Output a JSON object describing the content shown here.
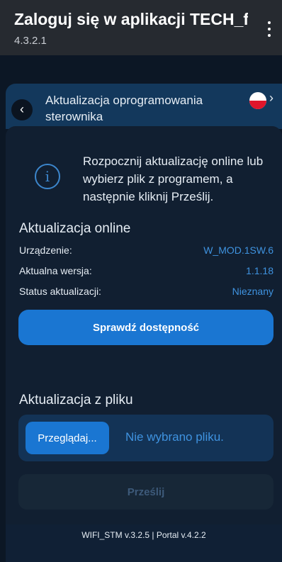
{
  "appbar": {
    "title": "Zaloguj się w aplikacji TECH_fb...",
    "version": "4.3.2.1",
    "menu_icon": "more-vert-icon"
  },
  "header": {
    "back_icon": "chevron-left-icon",
    "title": "Aktualizacja oprogramowania sterownika",
    "flag_icon": "poland-flag-icon",
    "flag_arrow_icon": "chevron-right-icon",
    "flag_arrow": "›"
  },
  "info": {
    "icon": "info-icon",
    "text": "Rozpocznij aktualizację online lub wybierz plik z programem, a następnie kliknij Prześlij."
  },
  "online": {
    "title": "Aktualizacja online",
    "rows": [
      {
        "label": "Urządzenie:",
        "value": "W_MOD.1SW.6"
      },
      {
        "label": "Aktualna wersja:",
        "value": "1.1.18"
      },
      {
        "label": "Status aktualizacji:",
        "value": "Nieznany"
      }
    ],
    "check_button": "Sprawdź dostępność"
  },
  "file": {
    "title": "Aktualizacja z pliku",
    "browse_button": "Przeglądaj...",
    "no_file": "Nie wybrano pliku.",
    "send_button": "Prześlij"
  },
  "footer": {
    "text": "WIFI_STM v.3.2.5 | Portal v.4.2.2"
  },
  "colors": {
    "accent": "#1a76d2",
    "link": "#3f93e0",
    "background": "#0c1725",
    "card": "#111f31"
  }
}
